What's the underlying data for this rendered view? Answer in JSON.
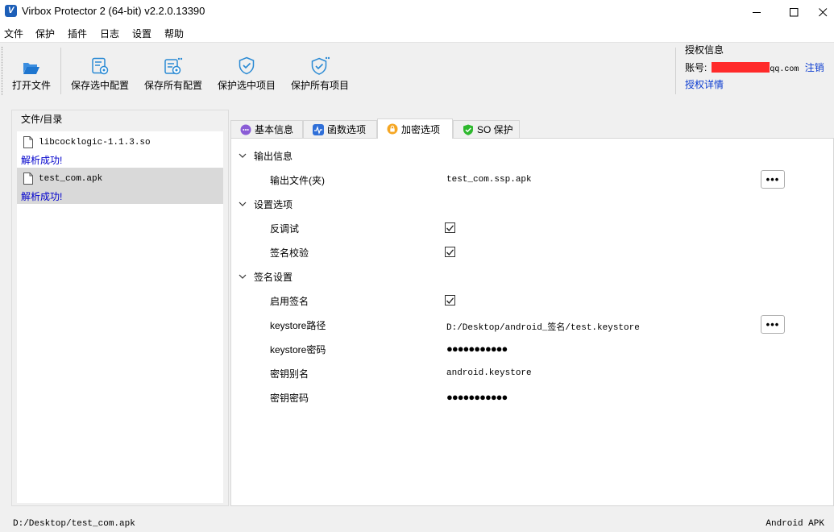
{
  "window": {
    "title": "Virbox Protector 2 (64-bit) v2.2.0.13390",
    "app_icon_letter": "V"
  },
  "menu": [
    "文件",
    "保护",
    "插件",
    "日志",
    "设置",
    "帮助"
  ],
  "toolbar": {
    "open_file": "打开文件",
    "save_selected_config": "保存选中配置",
    "save_all_config": "保存所有配置",
    "protect_selected": "保护选中项目",
    "protect_all": "保护所有项目"
  },
  "auth": {
    "title": "授权信息",
    "account_label": "账号:",
    "account_suffix": "qq.com",
    "logout": "注销",
    "details": "授权详情"
  },
  "left_panel": {
    "title": "文件/目录",
    "files": [
      {
        "name": "libcocklogic-1.1.3.so",
        "status": "解析成功!"
      },
      {
        "name": "test_com.apk",
        "status": "解析成功!"
      }
    ]
  },
  "tabs": {
    "basic": "基本信息",
    "functions": "函数选项",
    "encryption": "加密选项",
    "so_protect": "SO 保护"
  },
  "sections": {
    "output": {
      "title": "输出信息",
      "output_file_label": "输出文件(夹)",
      "output_file_value": "test_com.ssp.apk"
    },
    "settings": {
      "title": "设置选项",
      "anti_debug_label": "反调试",
      "anti_debug_checked": true,
      "sig_verify_label": "签名校验",
      "sig_verify_checked": true
    },
    "signing": {
      "title": "签名设置",
      "enable_sign_label": "启用签名",
      "enable_sign_checked": true,
      "keystore_path_label": "keystore路径",
      "keystore_path_value": "D:/Desktop/android_签名/test.keystore",
      "keystore_password_label": "keystore密码",
      "keystore_password_value": "●●●●●●●●●●●",
      "key_alias_label": "密钥别名",
      "key_alias_value": "android.keystore",
      "key_password_label": "密钥密码",
      "key_password_value": "●●●●●●●●●●●"
    }
  },
  "browse_button_label": "•••",
  "statusbar": {
    "path": "D:/Desktop/test_com.apk",
    "type": "Android APK"
  },
  "colors": {
    "accent_blue": "#2a8ad4",
    "link_blue": "#0a3bd0",
    "status_blue": "#0000cc",
    "redaction": "#ff2a2a"
  }
}
